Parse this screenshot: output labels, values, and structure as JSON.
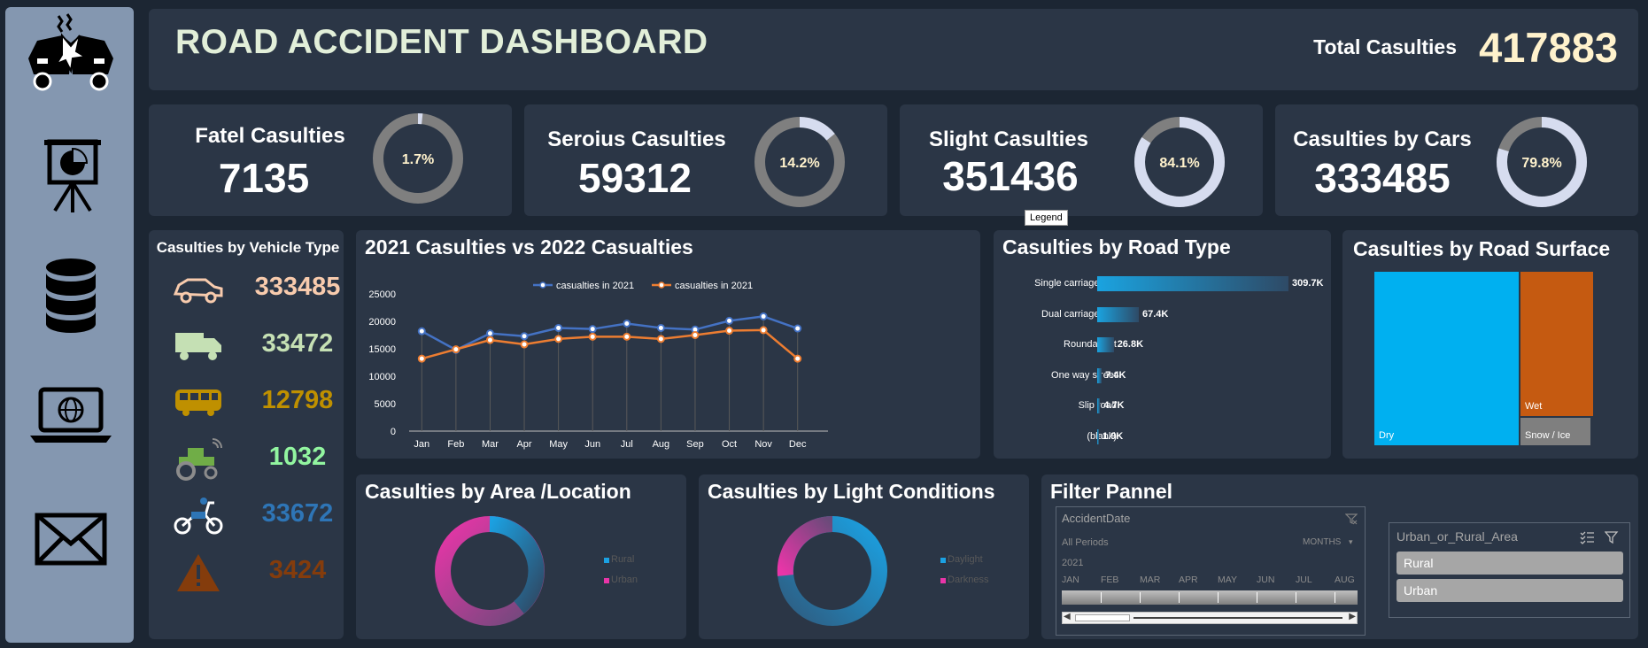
{
  "header": {
    "title": "ROAD ACCIDENT DASHBOARD",
    "total_label": "Total Casulties",
    "total_value": "417883"
  },
  "sidebar": {
    "icons": [
      "car-crash-icon",
      "presentation-chart-icon",
      "database-icon",
      "laptop-globe-icon",
      "envelope-icon"
    ]
  },
  "kpis": [
    {
      "label": "Fatel Casulties",
      "value": "7135",
      "pct_label": "1.7%",
      "pct": 0.017
    },
    {
      "label": "Seroius Casulties",
      "value": "59312",
      "pct_label": "14.2%",
      "pct": 0.142
    },
    {
      "label": "Slight Casulties",
      "value": "351436",
      "pct_label": "84.1%",
      "pct": 0.841
    },
    {
      "label": "Casulties by Cars",
      "value": "333485",
      "pct_label": "79.8%",
      "pct": 0.798
    }
  ],
  "vehicle_type": {
    "title": "Casulties by Vehicle Type",
    "rows": [
      {
        "icon": "car-icon",
        "value": "333485",
        "color": "#f8cbad"
      },
      {
        "icon": "truck-icon",
        "value": "33472",
        "color": "#c5e0b4"
      },
      {
        "icon": "bus-icon",
        "value": "12798",
        "color": "#bf9000"
      },
      {
        "icon": "tractor-icon",
        "value": "1032",
        "color": "#92f5a0"
      },
      {
        "icon": "motorbike-icon",
        "value": "33672",
        "color": "#2e75b6"
      },
      {
        "icon": "warning-icon",
        "value": "3424",
        "color": "#843c0c"
      }
    ]
  },
  "line_chart": {
    "title": "2021 Casulties vs 2022 Casualties",
    "tooltip": "Legend",
    "chart_data": {
      "type": "line",
      "x": [
        "Jan",
        "Feb",
        "Mar",
        "Apr",
        "May",
        "Jun",
        "Jul",
        "Aug",
        "Sep",
        "Oct",
        "Nov",
        "Dec"
      ],
      "ylim": [
        0,
        25000
      ],
      "yticks": [
        "0",
        "5000",
        "10000",
        "15000",
        "20000",
        "25000"
      ],
      "series": [
        {
          "name": "casualties in 2021",
          "color": "#4472c4",
          "values": [
            18200,
            14800,
            17800,
            17300,
            18800,
            18600,
            19600,
            18800,
            18500,
            20100,
            20900,
            18700
          ]
        },
        {
          "name": "casualties in 2021",
          "color": "#ed7d31",
          "values": [
            13200,
            14900,
            16600,
            15800,
            16800,
            17200,
            17200,
            16800,
            17500,
            18300,
            18400,
            13200
          ]
        }
      ]
    }
  },
  "road_type": {
    "title": "Casulties by Road Type",
    "chart_data": {
      "type": "bar",
      "categories": [
        "Single carriageway",
        "Dual carriageway",
        "Roundabout",
        "One way street",
        "Slip road",
        "(blank)"
      ],
      "values": [
        309.7,
        67.4,
        26.8,
        7.4,
        4.7,
        1.9
      ],
      "labels": [
        "309.7K",
        "67.4K",
        "26.8K",
        "7.4K",
        "4.7K",
        "1.9K"
      ]
    }
  },
  "road_surface": {
    "title": "Casulties by Road Surface",
    "labels": [
      "Dry",
      "Wet",
      "Snow / Ice"
    ]
  },
  "area": {
    "title": "Casulties by Area /Location",
    "legend": [
      "Rural",
      "Urban"
    ]
  },
  "light": {
    "title": "Casulties by Light Conditions",
    "legend": [
      "Daylight",
      "Darkness"
    ]
  },
  "filter": {
    "title": "Filter Pannel",
    "timeline": {
      "field": "AccidentDate",
      "periods": "All Periods",
      "unit": "MONTHS",
      "year": "2021",
      "months": [
        "JAN",
        "FEB",
        "MAR",
        "APR",
        "MAY",
        "JUN",
        "JUL",
        "AUG"
      ]
    },
    "slicer": {
      "field": "Urban_or_Rural_Area",
      "items": [
        "Rural",
        "Urban"
      ]
    }
  }
}
